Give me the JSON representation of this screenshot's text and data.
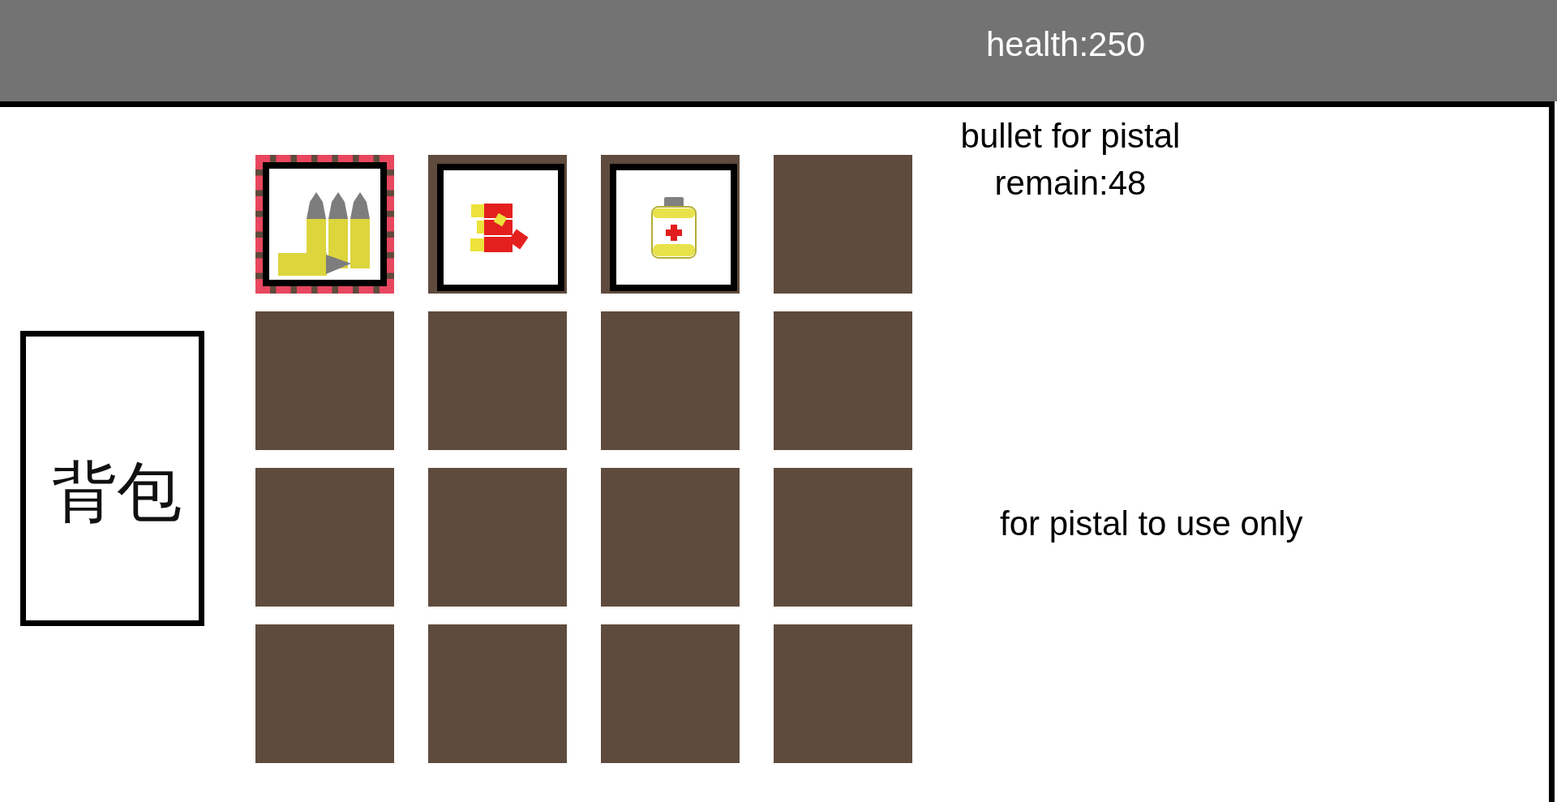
{
  "status_bar": {
    "health": "health:250"
  },
  "backpack_button": {
    "label": "背包"
  },
  "inventory": {
    "slots": [
      {
        "kind": "bullets",
        "selected": true
      },
      {
        "kind": "shells",
        "selected": false
      },
      {
        "kind": "medkit",
        "selected": false
      },
      {
        "kind": "empty",
        "selected": false
      },
      {
        "kind": "empty",
        "selected": false
      },
      {
        "kind": "empty",
        "selected": false
      },
      {
        "kind": "empty",
        "selected": false
      },
      {
        "kind": "empty",
        "selected": false
      },
      {
        "kind": "empty",
        "selected": false
      },
      {
        "kind": "empty",
        "selected": false
      },
      {
        "kind": "empty",
        "selected": false
      },
      {
        "kind": "empty",
        "selected": false
      },
      {
        "kind": "empty",
        "selected": false
      },
      {
        "kind": "empty",
        "selected": false
      },
      {
        "kind": "empty",
        "selected": false
      },
      {
        "kind": "empty",
        "selected": false
      }
    ]
  },
  "item_info": {
    "name": "bullet for pistal",
    "remain": "remain:48",
    "description": "for pistal to use only"
  }
}
